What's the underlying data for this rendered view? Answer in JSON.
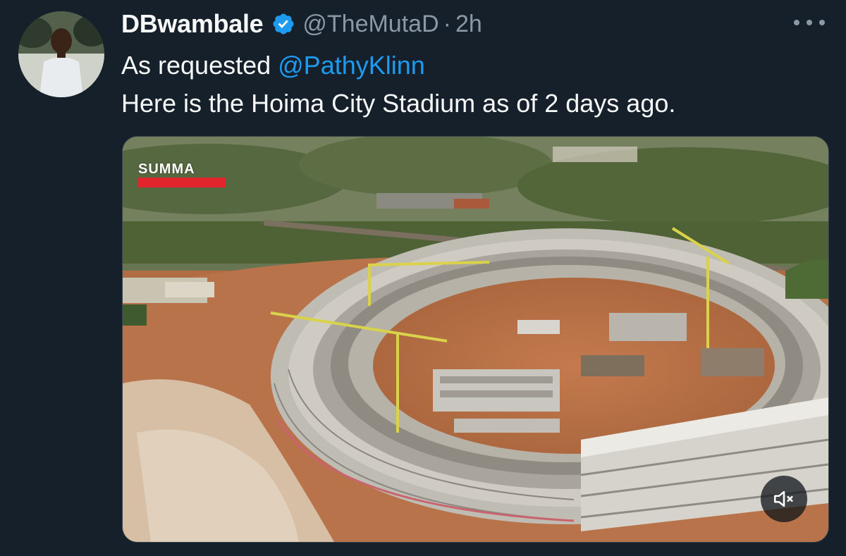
{
  "tweet": {
    "display_name": "DBwambale",
    "handle": "@TheMutaD",
    "separator": "·",
    "time": "2h",
    "text_line1_prefix": "As requested ",
    "mention": "@PathyKlinn",
    "text_line2": "Here is the Hoima City Stadium as of 2 days ago."
  },
  "media": {
    "watermark": "SUMMA",
    "alt": "Aerial view of Hoima City Stadium under construction",
    "mute_state": "muted"
  },
  "icons": {
    "verified": "verified-badge-icon",
    "more": "more-options-icon",
    "mute": "speaker-muted-icon"
  },
  "colors": {
    "background": "#15202b",
    "text": "#f7f9f9",
    "secondary": "#8b98a5",
    "link": "#1d9bf0",
    "verified": "#1d9bf0",
    "watermark_bar": "#e2252c"
  }
}
